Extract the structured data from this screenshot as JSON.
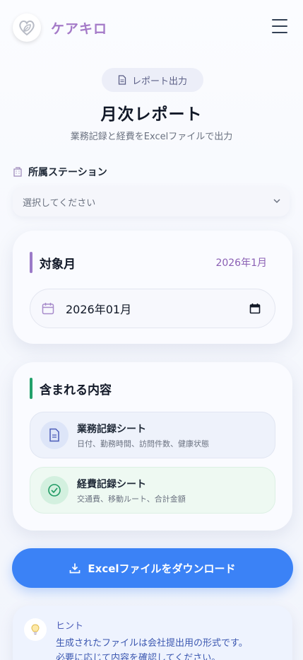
{
  "header": {
    "app_title": "ケアキロ",
    "logo_icon": "heart-leaf-icon",
    "menu_icon": "hamburger-menu-icon"
  },
  "intro": {
    "pill_label": "レポート出力",
    "pill_icon": "document-icon",
    "title": "月次レポート",
    "subtitle": "業務記録と経費をExcelファイルで出力"
  },
  "station": {
    "label": "所属ステーション",
    "icon": "building-icon",
    "select_value": "選択してください"
  },
  "target_month": {
    "heading": "対象月",
    "selected_month_tag": "2026年1月",
    "date_value": "2026年01月"
  },
  "contents": {
    "heading": "含まれる内容",
    "items": [
      {
        "title": "業務記録シート",
        "description": "日付、勤務時間、訪問件数、健康状態",
        "icon": "document-icon"
      },
      {
        "title": "経費記録シート",
        "description": "交通費、移動ルート、合計金額",
        "icon": "check-circle-icon"
      }
    ]
  },
  "download_button": {
    "label": "Excelファイルをダウンロード",
    "icon": "download-icon"
  },
  "hint": {
    "title": "ヒント",
    "line1": "生成されたファイルは会社提出用の形式です。",
    "line2": "必要に応じて内容を確認してください。",
    "icon": "lightbulb-icon"
  },
  "colors": {
    "brand_purple": "#a47ac8",
    "accent_blue": "#3b82f6",
    "month_bar": "#9b7ac8",
    "contents_bar": "#22a06b"
  }
}
